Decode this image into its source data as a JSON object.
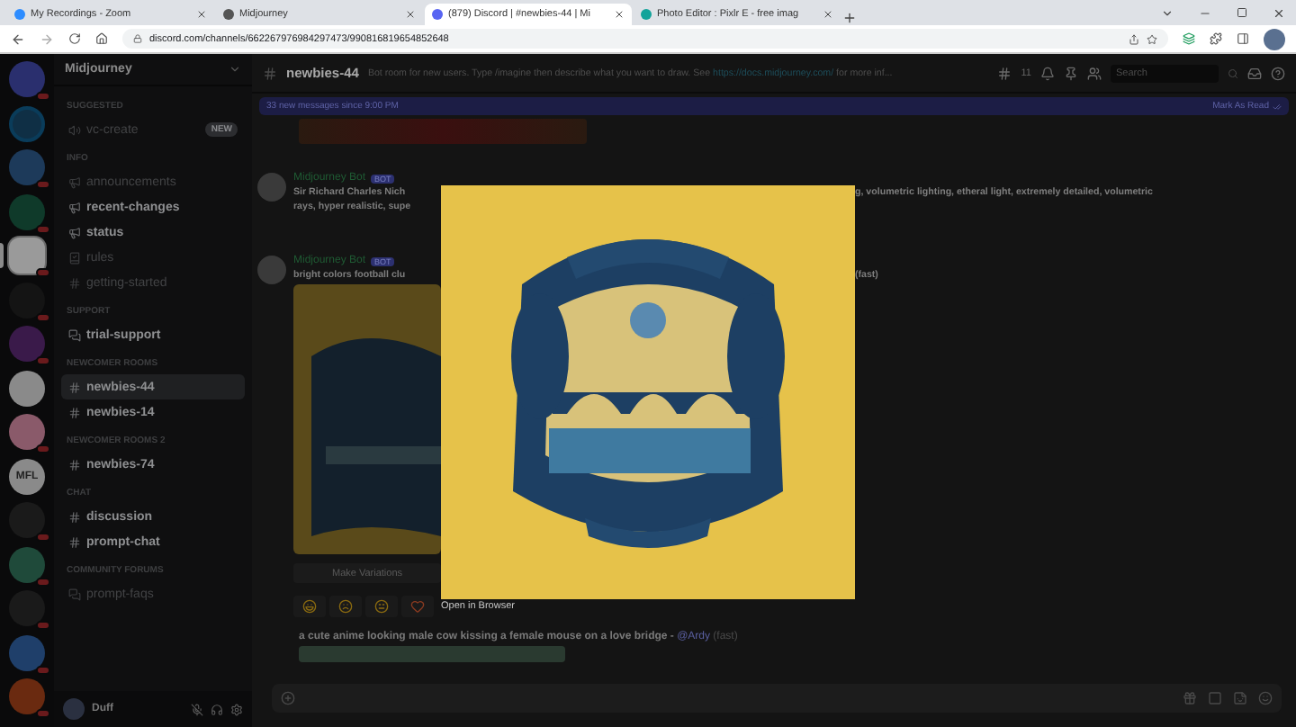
{
  "browser": {
    "tabs": [
      {
        "title": "My Recordings - Zoom",
        "selected": false
      },
      {
        "title": "Midjourney",
        "selected": false
      },
      {
        "title": "(879) Discord | #newbies-44 | Mi",
        "selected": true
      },
      {
        "title": "Photo Editor : Pixlr E - free imag",
        "selected": false
      }
    ],
    "url": "discord.com/channels/662267976984297473/990816819654852648"
  },
  "servers": [
    {
      "kind": "home",
      "color": "#2a2f6e",
      "selected": false,
      "badge": true
    },
    {
      "kind": "ring",
      "color": "#0f2f45",
      "selected": false,
      "badge": false
    },
    {
      "kind": "icon",
      "color": "#1d3a5a",
      "selected": false,
      "badge": true
    },
    {
      "kind": "icon",
      "color": "#0f3a2a",
      "selected": false,
      "badge": true
    },
    {
      "kind": "icon",
      "color": "#9a9a9a",
      "selected": true,
      "badge": true
    },
    {
      "kind": "icon",
      "color": "#141414",
      "selected": false,
      "badge": true
    },
    {
      "kind": "icon",
      "color": "#3a1a4a",
      "selected": false,
      "badge": true
    },
    {
      "kind": "icon",
      "color": "#8a8a8a",
      "selected": false,
      "badge": false
    },
    {
      "kind": "icon",
      "color": "#8a5a6a",
      "selected": false,
      "badge": true
    },
    {
      "kind": "text",
      "label": "MFL",
      "color": "#8a8a8a",
      "selected": false,
      "badge": false
    },
    {
      "kind": "icon",
      "color": "#1a1a1a",
      "selected": false,
      "badge": true
    },
    {
      "kind": "icon",
      "color": "#1f4a3a",
      "selected": false,
      "badge": true
    },
    {
      "kind": "icon",
      "color": "#1a1a1a",
      "selected": false,
      "badge": true
    },
    {
      "kind": "icon",
      "color": "#1f3f6a",
      "selected": false,
      "badge": true
    },
    {
      "kind": "icon",
      "color": "#6a2a10",
      "selected": false,
      "badge": true
    }
  ],
  "sidebar": {
    "server_name": "Midjourney",
    "categories": [
      {
        "name": "SUGGESTED",
        "channels": [
          {
            "name": "vc-create",
            "kind": "voice",
            "badge": "NEW",
            "unread": false,
            "selected": false
          }
        ]
      },
      {
        "name": "INFO",
        "channels": [
          {
            "name": "announcements",
            "kind": "announcement",
            "unread": false,
            "selected": false
          },
          {
            "name": "recent-changes",
            "kind": "announcement",
            "unread": true,
            "selected": false
          },
          {
            "name": "status",
            "kind": "announcement",
            "unread": true,
            "selected": false
          },
          {
            "name": "rules",
            "kind": "rules",
            "unread": false,
            "selected": false
          },
          {
            "name": "getting-started",
            "kind": "text",
            "unread": false,
            "selected": false
          }
        ]
      },
      {
        "name": "SUPPORT",
        "channels": [
          {
            "name": "trial-support",
            "kind": "forum",
            "unread": true,
            "selected": false
          }
        ]
      },
      {
        "name": "NEWCOMER ROOMS",
        "channels": [
          {
            "name": "newbies-44",
            "kind": "text",
            "unread": true,
            "selected": true
          },
          {
            "name": "newbies-14",
            "kind": "text",
            "unread": true,
            "selected": false
          }
        ]
      },
      {
        "name": "NEWCOMER ROOMS 2",
        "channels": [
          {
            "name": "newbies-74",
            "kind": "text",
            "unread": true,
            "selected": false
          }
        ]
      },
      {
        "name": "CHAT",
        "channels": [
          {
            "name": "discussion",
            "kind": "text",
            "unread": true,
            "selected": false
          },
          {
            "name": "prompt-chat",
            "kind": "text",
            "unread": true,
            "selected": false
          }
        ]
      },
      {
        "name": "COMMUNITY FORUMS",
        "channels": [
          {
            "name": "prompt-faqs",
            "kind": "forum",
            "unread": false,
            "selected": false
          }
        ]
      }
    ]
  },
  "user": {
    "name": "Duff"
  },
  "chat": {
    "channel": "newbies-44",
    "topic": "Bot room for new users. Type /imagine then describe what you want to draw. See",
    "topic_link": "https://docs.midjourney.com/",
    "topic_after": "for more inf...",
    "thread_count": "11",
    "search": {
      "placeholder": "Search"
    },
    "banner": {
      "text": "33 new messages since 9:00 PM",
      "action": "Mark As Read"
    },
    "messages": [
      {
        "author": "Midjourney Bot",
        "tag": "BOT",
        "lines": [
          {
            "left": "Sir Richard Charles Nich",
            "right": "g, volumetric lighting, etheral light, extremely detailed, volumetric"
          },
          {
            "left": "rays, hyper realistic, supe"
          }
        ]
      },
      {
        "author": "Midjourney Bot",
        "tag": "BOT",
        "lines": [
          {
            "left": "bright colors football clu",
            "right": "(fast)"
          }
        ],
        "image": true,
        "button": "Make Variations",
        "reactions": [
          {
            "kind": "laugh"
          },
          {
            "kind": "cry"
          },
          {
            "kind": "shock"
          },
          {
            "kind": "heart"
          }
        ]
      }
    ],
    "last_prompt": {
      "text": "a cute anime looking male cow kissing a female mouse on a love bridge - ",
      "mention": "@Ardy",
      "suffix": "(fast)"
    }
  },
  "lightbox": {
    "link": "Open in Browser"
  }
}
